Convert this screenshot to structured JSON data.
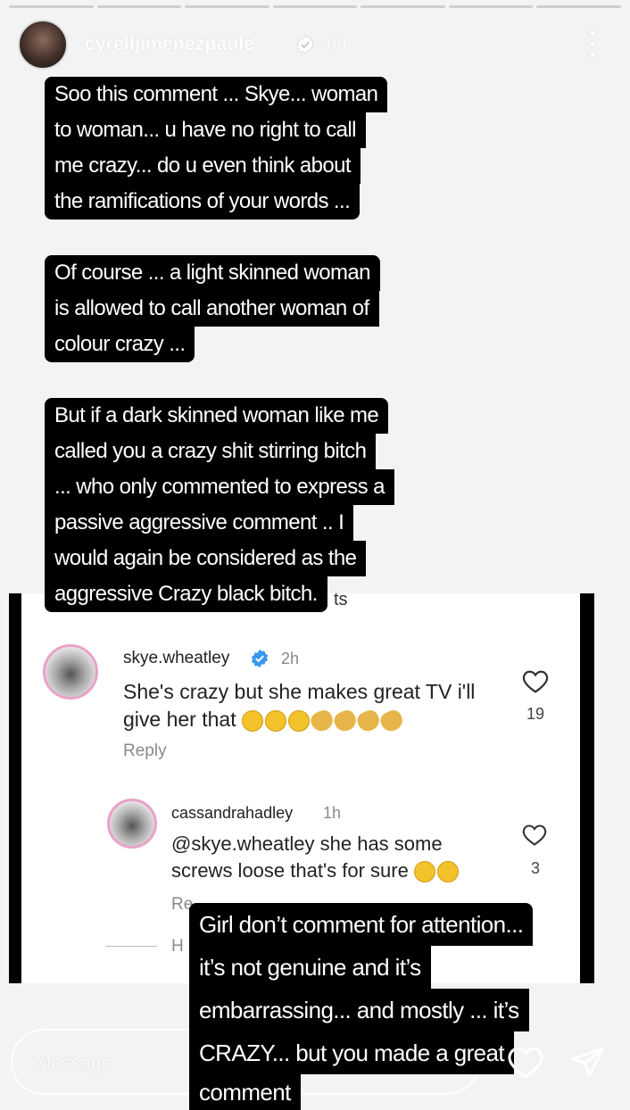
{
  "story": {
    "username": "cyrelljimenezpaule",
    "time": "6h",
    "captions": [
      {
        "lines": [
          "Soo this comment ... Skye... woman",
          "to woman... u have no right to call",
          "me crazy... do u even think about",
          "the ramifications of your words ..."
        ]
      },
      {
        "lines": [
          "Of course ... a light skinned woman",
          "is allowed to  call another woman of",
          "colour crazy ..."
        ]
      },
      {
        "lines": [
          "But if a dark skinned woman like me",
          "called you a crazy shit stirring bitch",
          "... who only commented to express a",
          "passive aggressive comment .. I",
          "would again be considered as the",
          "aggressive Crazy black bitch."
        ]
      },
      {
        "lines": [
          "Girl don’t comment for attention...",
          "it’s not genuine and it’s",
          "embarrassing... and mostly ... it’s",
          "CRAZY... but you made a great",
          "comment"
        ]
      }
    ]
  },
  "screenshot": {
    "partial_top_text": "ts",
    "comment1": {
      "username": "skye.wheatley",
      "time": "2h",
      "text_line1": "She's crazy but she makes great TV i'll",
      "text_line2": "give her that",
      "emoji_line2": [
        "laughing-face",
        "laughing-face",
        "laughing-face",
        "clapping-hands",
        "clapping-hands",
        "clapping-hands",
        "clapping-hands"
      ],
      "likes": "19",
      "reply": "Reply"
    },
    "comment2": {
      "username": "cassandrahadley",
      "time": "1h",
      "text_line1": "@skye.wheatley she has some",
      "text_line2": "screws loose that's for sure",
      "emoji_line2": [
        "eye-roll-face",
        "laughing-face"
      ],
      "likes": "3",
      "reply_partial": "Re",
      "hide_partial": "H"
    }
  },
  "footer": {
    "message_placeholder": "Message"
  },
  "icons": {
    "more": "more-vertical-icon",
    "heart": "heart-icon",
    "send": "send-icon",
    "verified": "verified-badge-icon"
  },
  "colors": {
    "verified_blue": "#3897f0",
    "caption_bg": "#000000",
    "caption_text": "#ffffff"
  }
}
